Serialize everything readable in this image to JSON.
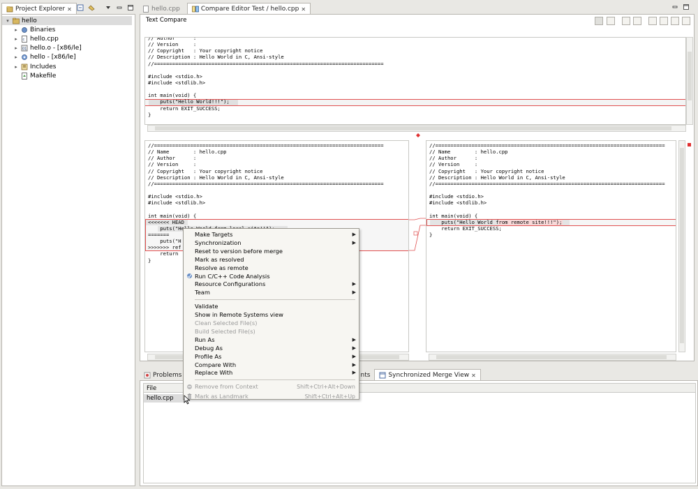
{
  "explorer": {
    "tab_label": "Project Explorer",
    "tree": [
      {
        "label": "hello",
        "level": 0,
        "expanded": true,
        "icon": "project-folder-icon"
      },
      {
        "label": "Binaries",
        "level": 1,
        "icon": "binaries-icon"
      },
      {
        "label": "hello.cpp",
        "level": 1,
        "icon": "cpp-file-icon"
      },
      {
        "label": "hello.o - [x86/le]",
        "level": 1,
        "icon": "object-file-icon"
      },
      {
        "label": "hello - [x86/le]",
        "level": 1,
        "icon": "executable-icon"
      },
      {
        "label": "Includes",
        "level": 1,
        "icon": "includes-icon"
      },
      {
        "label": "Makefile",
        "level": 1,
        "icon": "makefile-icon"
      }
    ]
  },
  "editor": {
    "tabs": [
      {
        "label": "hello.cpp",
        "active": false
      },
      {
        "label": "Compare Editor Test / hello.cpp",
        "active": true
      }
    ],
    "compare_title": "Text Compare",
    "top_code": [
      "// Author      :",
      "// Version     :",
      "// Copyright   : Your copyright notice",
      "// Description : Hello World in C, Ansi-style",
      "//============================================================================",
      "",
      "#include <stdio.h>",
      "#include <stdlib.h>",
      "",
      "int main(void) {",
      "    puts(\"Hello World!!!\");",
      "    return EXIT_SUCCESS;",
      "}"
    ],
    "left_code": [
      "//============================================================================",
      "// Name        : hello.cpp",
      "// Author      :",
      "// Version     :",
      "// Copyright   : Your copyright notice",
      "// Description : Hello World in C, Ansi-style",
      "//============================================================================",
      "",
      "#include <stdio.h>",
      "#include <stdlib.h>",
      "",
      "int main(void) {",
      "<<<<<<< HEAD",
      "    puts(\"Hello World from local site!!\");",
      "=======",
      "    puts(\"H",
      ">>>>>>> ref",
      "    return",
      "}"
    ],
    "right_code": [
      "//============================================================================",
      "// Name        : hello.cpp",
      "// Author      :",
      "// Version     :",
      "// Copyright   : Your copyright notice",
      "// Description : Hello World in C, Ansi-style",
      "//============================================================================",
      "",
      "#include <stdio.h>",
      "#include <stdlib.h>",
      "",
      "int main(void) {",
      "    puts(\"Hello World from remote site!!!\");",
      "    return EXIT_SUCCESS;",
      "}"
    ]
  },
  "bottom": {
    "tabs": [
      {
        "label": "Problems",
        "active": false
      },
      {
        "label": "nts",
        "active": false
      },
      {
        "label": "Synchronized Merge View",
        "active": true
      }
    ],
    "column_header": "File",
    "rows": [
      "hello.cpp"
    ]
  },
  "context_menu": {
    "items": [
      {
        "label": "Make Targets",
        "submenu": true
      },
      {
        "label": "Synchronization",
        "submenu": true
      },
      {
        "label": "Reset to version before merge"
      },
      {
        "label": "Mark as resolved"
      },
      {
        "label": "Resolve as remote"
      },
      {
        "label": "Run C/C++ Code Analysis",
        "icon": "code-analysis-icon"
      },
      {
        "label": "Resource Configurations",
        "submenu": true
      },
      {
        "label": "Team",
        "submenu": true
      },
      {
        "separator": true
      },
      {
        "label": "Validate"
      },
      {
        "label": "Show in Remote Systems view"
      },
      {
        "label": "Clean Selected File(s)",
        "disabled": true
      },
      {
        "label": "Build Selected File(s)",
        "disabled": true
      },
      {
        "label": "Run As",
        "submenu": true
      },
      {
        "label": "Debug As",
        "submenu": true
      },
      {
        "label": "Profile As",
        "submenu": true
      },
      {
        "label": "Compare With",
        "submenu": true
      },
      {
        "label": "Replace With",
        "submenu": true
      },
      {
        "separator": true
      },
      {
        "label": "Remove from Context",
        "shortcut": "Shift+Ctrl+Alt+Down",
        "disabled": true,
        "icon": "remove-context-icon"
      },
      {
        "label": "Mark as Landmark",
        "shortcut": "Shift+Ctrl+Alt+Up",
        "disabled": true,
        "icon": "landmark-icon"
      }
    ]
  },
  "colors": {
    "conflict_border": "#e05050",
    "change_bg": "#ececec",
    "selection_bg": "#dcdcdc",
    "highlight_red_bg": "#f8d8d8"
  }
}
